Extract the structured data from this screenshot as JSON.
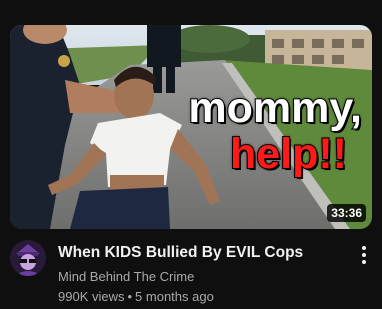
{
  "video": {
    "thumbnail_text_line1": "mommy,",
    "thumbnail_text_line2": "help!!",
    "duration": "33:36",
    "title": "When KIDS Bullied By EVIL Cops",
    "channel": "Mind Behind The Crime",
    "views": "990K views",
    "separator": "•",
    "age": "5 months ago",
    "more_icon": "vertical-ellipsis-icon",
    "avatar_icon": "channel-avatar-icon"
  },
  "colors": {
    "background": "#0f0f0f",
    "title": "#f1f1f1",
    "secondary": "#aaaaaa",
    "overlay_white": "#ffffff",
    "overlay_red": "#ff1a1a"
  }
}
